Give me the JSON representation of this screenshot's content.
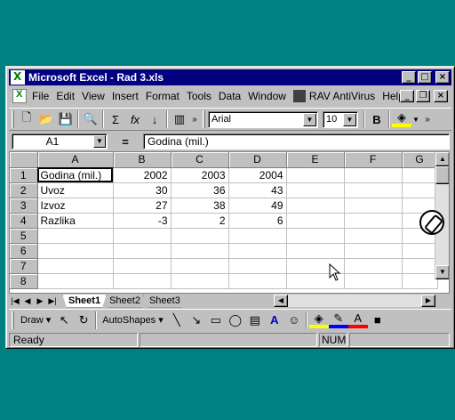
{
  "window": {
    "title": "Microsoft Excel - Rad 3.xls"
  },
  "menu": [
    "File",
    "Edit",
    "View",
    "Insert",
    "Format",
    "Tools",
    "Data",
    "Window",
    "RAV AntiVirus",
    "Help"
  ],
  "toolbar": {
    "font": "Arial",
    "size": "10",
    "bold": "B",
    "sigma": "Σ",
    "fx": "fx"
  },
  "formula_bar": {
    "name_box": "A1",
    "equals": "=",
    "content": "Godina (mil.)"
  },
  "columns": [
    "A",
    "B",
    "C",
    "D",
    "E",
    "F",
    "G"
  ],
  "rows": [
    {
      "num": "1",
      "cells": [
        "Godina (mil.)",
        "2002",
        "2003",
        "2004",
        "",
        "",
        ""
      ]
    },
    {
      "num": "2",
      "cells": [
        "Uvoz",
        "30",
        "36",
        "43",
        "",
        "",
        ""
      ]
    },
    {
      "num": "3",
      "cells": [
        "Izvoz",
        "27",
        "38",
        "49",
        "",
        "",
        ""
      ]
    },
    {
      "num": "4",
      "cells": [
        "Razlika",
        "-3",
        "2",
        "6",
        "",
        "",
        ""
      ]
    },
    {
      "num": "5",
      "cells": [
        "",
        "",
        "",
        "",
        "",
        "",
        ""
      ]
    },
    {
      "num": "6",
      "cells": [
        "",
        "",
        "",
        "",
        "",
        "",
        ""
      ]
    },
    {
      "num": "7",
      "cells": [
        "",
        "",
        "",
        "",
        "",
        "",
        ""
      ]
    },
    {
      "num": "8",
      "cells": [
        "",
        "",
        "",
        "",
        "",
        "",
        ""
      ]
    }
  ],
  "sheets": [
    "Sheet1",
    "Sheet2",
    "Sheet3"
  ],
  "drawing": {
    "draw": "Draw",
    "autoshapes": "AutoShapes"
  },
  "status": {
    "ready": "Ready",
    "num": "NUM"
  }
}
